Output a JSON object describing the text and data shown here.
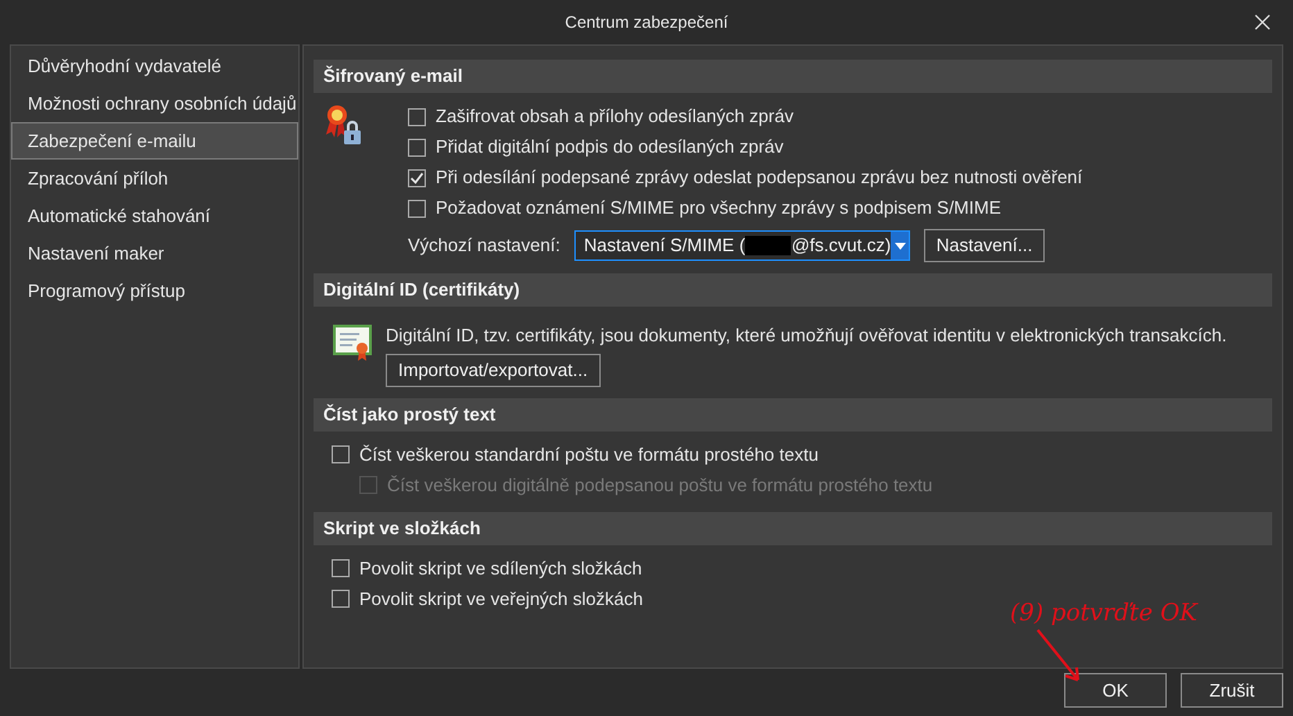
{
  "window": {
    "title": "Centrum zabezpečení"
  },
  "sidebar": {
    "items": [
      {
        "label": "Důvěryhodní vydavatelé",
        "selected": false
      },
      {
        "label": "Možnosti ochrany osobních údajů",
        "selected": false
      },
      {
        "label": "Zabezpečení e-mailu",
        "selected": true
      },
      {
        "label": "Zpracování příloh",
        "selected": false
      },
      {
        "label": "Automatické stahování",
        "selected": false
      },
      {
        "label": "Nastavení maker",
        "selected": false
      },
      {
        "label": "Programový přístup",
        "selected": false
      }
    ]
  },
  "sections": [
    {
      "title": "Šifrovaný e-mail",
      "kind": "encryption",
      "checkboxes": [
        {
          "label": "Zašifrovat obsah a přílohy odesílaných zpráv",
          "checked": false,
          "disabled": false
        },
        {
          "label": "Přidat digitální podpis do odesílaných zpráv",
          "checked": false,
          "disabled": false
        },
        {
          "label": "Při odesílání podepsané zprávy odeslat podepsanou zprávu bez nutnosti ověření",
          "checked": true,
          "disabled": false
        },
        {
          "label": "Požadovat oznámení S/MIME pro všechny zprávy s podpisem S/MIME",
          "checked": false,
          "disabled": false
        }
      ],
      "default_label": "Výchozí nastavení:",
      "select_prefix": "Nastavení S/MIME (",
      "select_suffix": "@fs.cvut.cz)",
      "settings_button": "Nastavení..."
    },
    {
      "title": "Digitální ID (certifikáty)",
      "kind": "certificates",
      "description": "Digitální ID, tzv. certifikáty, jsou dokumenty, které umožňují ověřovat identitu v elektronických transakcích.",
      "button": "Importovat/exportovat..."
    },
    {
      "title": "Číst jako prostý text",
      "kind": "plain",
      "checkboxes": [
        {
          "label": "Číst veškerou standardní poštu ve formátu prostého textu",
          "checked": false,
          "disabled": false,
          "indented": false
        },
        {
          "label": "Číst veškerou digitálně podepsanou poštu ve formátu prostého textu",
          "checked": false,
          "disabled": true,
          "indented": true
        }
      ]
    },
    {
      "title": "Skript ve složkách",
      "kind": "plain",
      "checkboxes": [
        {
          "label": "Povolit skript ve sdílených složkách",
          "checked": false,
          "disabled": false,
          "indented": false
        },
        {
          "label": "Povolit skript ve veřejných složkách",
          "checked": false,
          "disabled": false,
          "indented": false
        }
      ]
    }
  ],
  "annotation": "(9) potvrďte OK",
  "buttons": [
    "OK",
    "Zrušit"
  ]
}
